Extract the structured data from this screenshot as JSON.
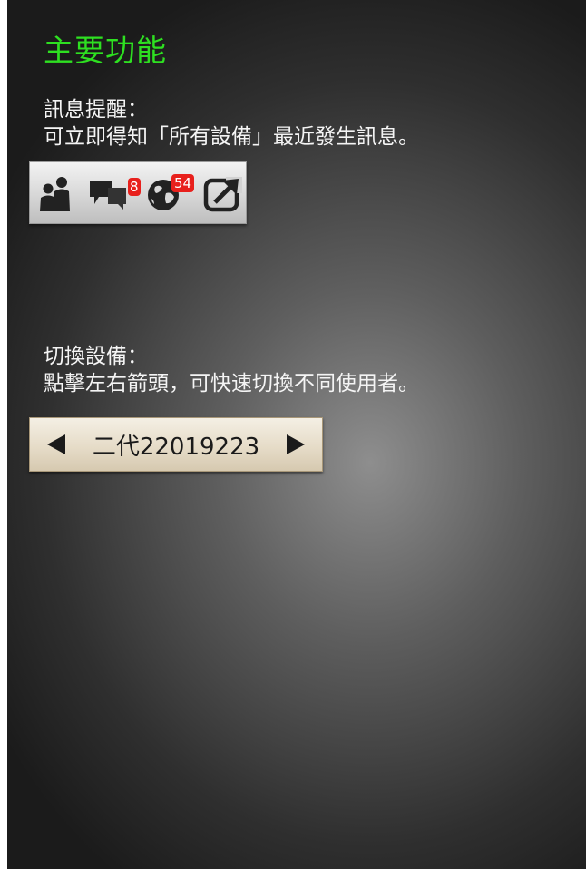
{
  "title": "主要功能",
  "section_notify": {
    "heading": "訊息提醒：",
    "text": "可立即得知「所有設備」最近發生訊息。"
  },
  "icon_bar": {
    "icons": [
      "users-icon",
      "chat-bubbles-icon",
      "globe-icon",
      "share-icon"
    ],
    "message_badge": "8",
    "globe_badge": "54",
    "badge_color": "#e8201c"
  },
  "section_switch": {
    "heading": "切換設備：",
    "text": "點擊左右箭頭，可快速切換不同使用者。"
  },
  "device_switcher": {
    "current_device": "二代22019223",
    "prev_icon": "arrow-left-icon",
    "next_icon": "arrow-right-icon"
  },
  "colors": {
    "title_green": "#2ee021",
    "text": "#f4f4f4"
  }
}
